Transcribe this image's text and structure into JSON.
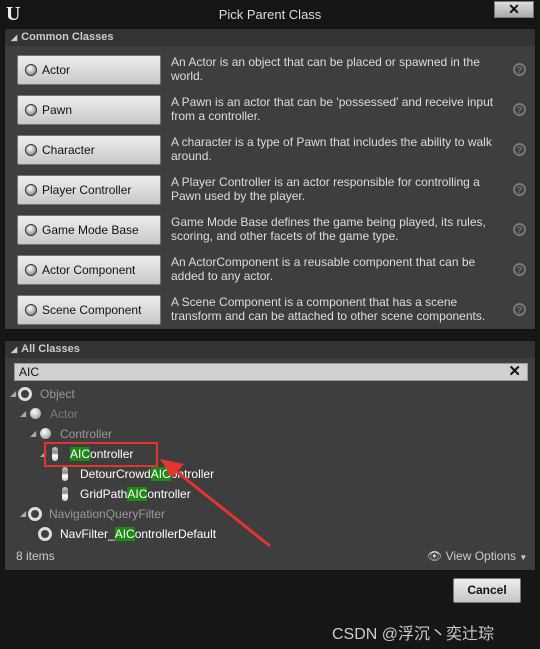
{
  "window": {
    "title": "Pick Parent Class",
    "logo": "U",
    "close_icon": "close-icon"
  },
  "common": {
    "header": "Common Classes",
    "items": [
      {
        "label": "Actor",
        "icon": "actor-sphere-icon",
        "desc": "An Actor is an object that can be placed or spawned in the world."
      },
      {
        "label": "Pawn",
        "icon": "pawn-icon",
        "desc": "A Pawn is an actor that can be 'possessed' and receive input from a controller."
      },
      {
        "label": "Character",
        "icon": "character-icon",
        "desc": "A character is a type of Pawn that includes the ability to walk around."
      },
      {
        "label": "Player Controller",
        "icon": "player-controller-icon",
        "desc": "A Player Controller is an actor responsible for controlling a Pawn used by the player."
      },
      {
        "label": "Game Mode Base",
        "icon": "game-mode-icon",
        "desc": "Game Mode Base defines the game being played, its rules, scoring, and other facets of the game type."
      },
      {
        "label": "Actor Component",
        "icon": "actor-component-icon",
        "desc": "An ActorComponent is a reusable component that can be added to any actor."
      },
      {
        "label": "Scene Component",
        "icon": "scene-component-icon",
        "desc": "A Scene Component is a component that has a scene transform and can be attached to other scene components."
      }
    ],
    "help": "?"
  },
  "all": {
    "header": "All Classes",
    "search": "AIC",
    "tree": [
      {
        "pre": "Object",
        "match": "",
        "post": "",
        "dim": true
      },
      {
        "pre": "Actor",
        "match": "",
        "post": "",
        "dim": true
      },
      {
        "pre": "Controller",
        "match": "",
        "post": "",
        "dim": true
      },
      {
        "pre": "",
        "match": "AIC",
        "post": "ontroller",
        "selected": true
      },
      {
        "pre": "DetourCrowd",
        "match": "AIC",
        "post": "ontroller"
      },
      {
        "pre": "GridPath",
        "match": "AIC",
        "post": "ontroller"
      },
      {
        "pre": "NavigationQueryFilter",
        "match": "",
        "post": "",
        "dim": true
      },
      {
        "pre": "NavFilter_",
        "match": "AIC",
        "post": "ontrollerDefault"
      }
    ],
    "count": "8 items",
    "view_options": "View Options"
  },
  "footer": {
    "cancel": "Cancel"
  },
  "watermark": "CSDN @浮沉丶奕辻琮",
  "colors": {
    "highlight": "#1d8a14",
    "annotation": "#e53333"
  }
}
